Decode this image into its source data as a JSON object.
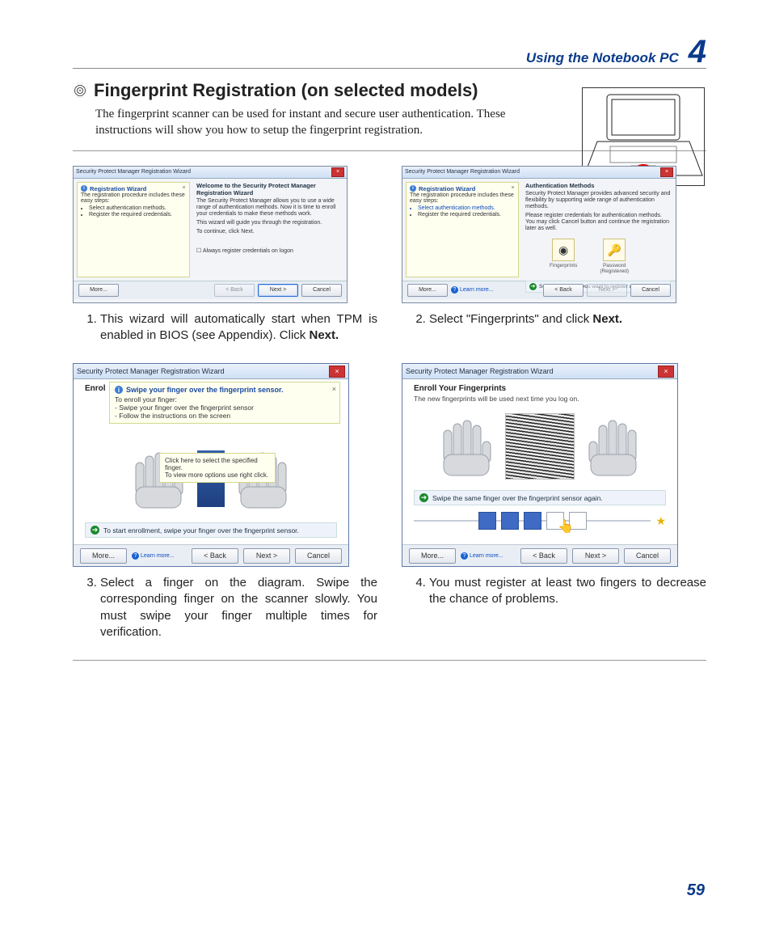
{
  "header": {
    "section": "Using the Notebook PC",
    "chapter": "4"
  },
  "title": "Fingerprint Registration (on selected models)",
  "intro": "The fingerprint scanner can be used for instant and secure user authentication. These instructions will show you how to setup the fingerprint registration.",
  "page_number": "59",
  "wizard_common": {
    "window_title": "Security Protect Manager Registration Wizard",
    "buttons": {
      "more": "More...",
      "back": "< Back",
      "next": "Next >",
      "cancel": "Cancel",
      "learn": "Learn more..."
    }
  },
  "step1": {
    "tip_title": "Registration Wizard",
    "tip_intro": "The registration procedure includes these easy steps:",
    "tip_items": [
      "Select authentication methods.",
      "Register the required credentials."
    ],
    "welcome_title": "Welcome to the Security Protect Manager Registration Wizard",
    "welcome_p1": "The Security Protect Manager allows you to use a wide range of authentication methods. Now it is time to enroll your credentials to make these methods work.",
    "welcome_p2": "This wizard will guide you through the registration.",
    "welcome_p3": "To continue, click Next.",
    "checkbox": "Always register credentials on logon",
    "caption_pre": "This wizard will automatically start when TPM is enabled in BIOS (see  Appendix). Click ",
    "caption_bold": "Next."
  },
  "step2": {
    "tip_title": "Registration Wizard",
    "tip_intro": "The registration procedure includes these easy steps:",
    "tip_items": [
      "Select authentication methods.",
      "Register the required credentials."
    ],
    "auth_title": "Authentication Methods",
    "auth_sub": "Security Protect Manager provides advanced security and flexibility by supporting wide range of authentication methods.",
    "auth_instr": "Please register credentials for authentication methods. You may click Cancel button and continue the registration later as well.",
    "method_fp": "Fingerprints",
    "method_pw_line1": "Password",
    "method_pw_line2": "(Registered)",
    "cred_line": "Select credentials you want to register and click Next.",
    "caption_pre": "Select \"Fingerprints\" and click ",
    "caption_bold": "Next."
  },
  "step3": {
    "enroll_head": "Enrol",
    "enroll_desc_head": "To enroll your finger:",
    "enroll_desc_items": [
      "- Swipe your finger over the fingerprint sensor",
      "- Follow the instructions on the screen"
    ],
    "tooltip_title": "Swipe your finger over the fingerprint sensor.",
    "hint_line1": "Click here to select the specified finger.",
    "hint_line2": "To view more options use right click.",
    "prompt": "To start enrollment, swipe your finger over the fingerprint sensor.",
    "caption": "Select a finger on the diagram. Swipe the corresponding finger on the scanner slowly. You must swipe your finger multiple times for verification."
  },
  "step4": {
    "enroll_title": "Enroll Your Fingerprints",
    "enroll_sub": "The new fingerprints will be used next time you log on.",
    "prompt": "Swipe the same finger over the fingerprint sensor again.",
    "caption": "You must register at least two fingers to decrease the chance of problems."
  }
}
